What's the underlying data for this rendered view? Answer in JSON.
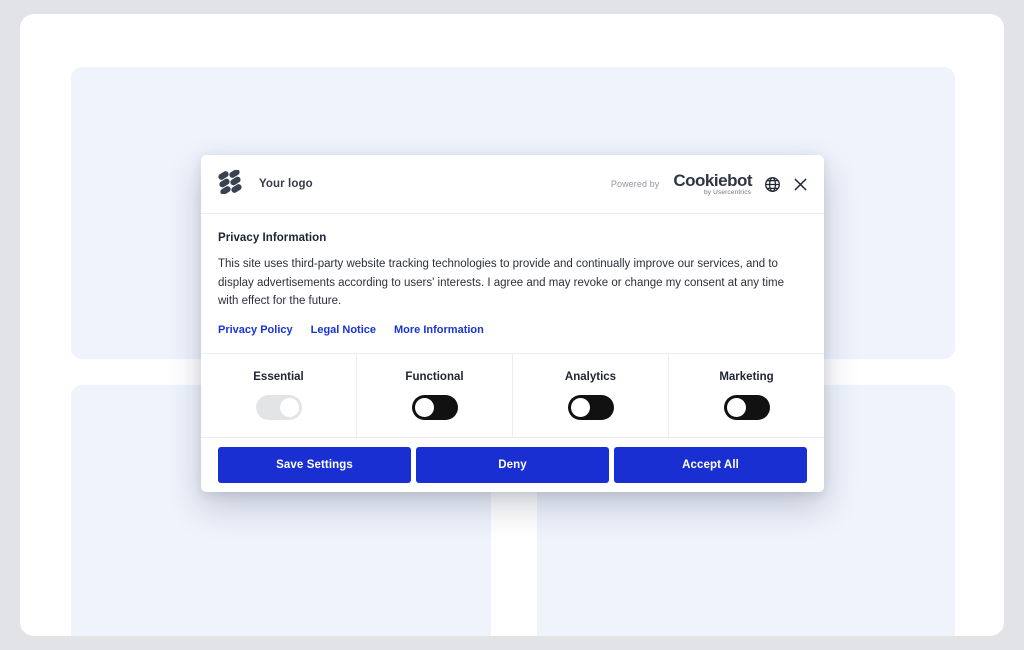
{
  "background": {
    "canvas_color": "#ffffff",
    "outer_color": "#e2e3e7",
    "placeholder_color": "#eef3fc"
  },
  "dialog": {
    "header": {
      "logo_icon": "dots-grid-logo-icon",
      "brand_name": "Your logo",
      "powered_by_label": "Powered by",
      "provider_name": "Cookiebot",
      "provider_subtitle": "by Usercentrics",
      "language_icon": "globe-icon",
      "close_icon": "close-icon"
    },
    "content": {
      "title": "Privacy Information",
      "body": "This site uses third-party website tracking technologies to provide and continually improve our services, and to display advertisements according to users' interests. I agree and may revoke or change my consent at any time with effect for the future.",
      "links": [
        {
          "label": "Privacy Policy"
        },
        {
          "label": "Legal Notice"
        },
        {
          "label": "More Information"
        }
      ],
      "link_color": "#1a34d4"
    },
    "categories": [
      {
        "label": "Essential",
        "state": "on",
        "locked": true,
        "track_color": "#e3e4e6"
      },
      {
        "label": "Functional",
        "state": "off",
        "locked": false,
        "track_color": "#111111"
      },
      {
        "label": "Analytics",
        "state": "off",
        "locked": false,
        "track_color": "#111111"
      },
      {
        "label": "Marketing",
        "state": "off",
        "locked": false,
        "track_color": "#111111"
      }
    ],
    "actions": [
      {
        "label": "Save Settings"
      },
      {
        "label": "Deny"
      },
      {
        "label": "Accept All"
      }
    ],
    "button_color": "#1a2fd1"
  }
}
